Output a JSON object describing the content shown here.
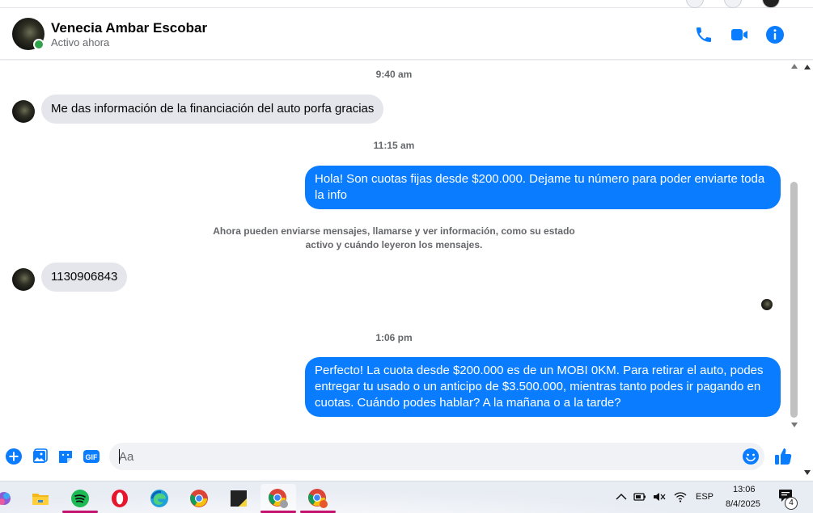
{
  "header": {
    "contact_name": "Venecia Ambar Escobar",
    "status": "Activo ahora",
    "actions": [
      "phone-icon",
      "video-icon",
      "info-icon"
    ]
  },
  "messages": {
    "ts1": "9:40 am",
    "in1": "Me das información de la financiación del auto porfa gracias",
    "ts2": "11:15 am",
    "out1": "Hola! Son cuotas fijas desde $200.000. Dejame tu número para poder enviarte toda la info",
    "system_note": "Ahora pueden enviarse mensajes, llamarse y ver información, como su estado activo y cuándo leyeron los mensajes.",
    "in2": "1130906843",
    "ts3": "1:06 pm",
    "out2": "Perfecto! La cuota desde $200.000 es de un MOBI 0KM. Para retirar el auto, podes entregar tu usado o un anticipo de $3.500.000, mientras tanto podes ir pagando en cuotas. Cuándo podes hablar? A la mañana o a la tarde?"
  },
  "composer": {
    "placeholder": "Aa",
    "value": "",
    "icons": [
      "plus-icon",
      "photo-icon",
      "sticker-icon",
      "gif-icon",
      "emoji-icon",
      "like-icon"
    ],
    "gif_label": "GIF"
  },
  "taskbar": {
    "apps": [
      "copilot",
      "file-explorer",
      "spotify",
      "opera",
      "edge",
      "chrome",
      "sticky-notes",
      "chrome-profile",
      "chrome-profile-2"
    ],
    "language": "ESP",
    "time": "13:06",
    "date": "8/4/2025",
    "notification_count": "4"
  },
  "colors": {
    "accent": "#0a7cff",
    "incoming_bubble": "#e4e6eb",
    "online": "#31a24c"
  }
}
